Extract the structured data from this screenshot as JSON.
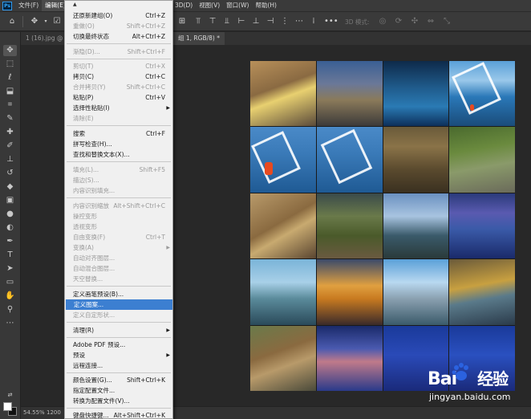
{
  "menubar": {
    "logo": "Ps",
    "items": [
      "文件(F)",
      "编辑(E)"
    ],
    "right_items": [
      "3D(D)",
      "视图(V)",
      "窗口(W)",
      "帮助(H)"
    ]
  },
  "optionsbar": {
    "mode_3d": "3D 模式:"
  },
  "tabs": [
    {
      "label": "1 (16).jpg @"
    },
    {
      "label": "组 1, RGB/8) *"
    }
  ],
  "statusbar": {
    "zoom": "54.55%",
    "size": "1200"
  },
  "edit_menu": {
    "items": [
      {
        "label": "还原新建组(O)",
        "shortcut": "Ctrl+Z",
        "disabled": false
      },
      {
        "label": "重做(O)",
        "shortcut": "Shift+Ctrl+Z",
        "disabled": true
      },
      {
        "label": "切换最终状态",
        "shortcut": "Alt+Ctrl+Z",
        "disabled": false
      },
      {
        "label": "渐隐(D)...",
        "shortcut": "Shift+Ctrl+F",
        "disabled": true
      },
      {
        "label": "剪切(T)",
        "shortcut": "Ctrl+X",
        "disabled": true
      },
      {
        "label": "拷贝(C)",
        "shortcut": "Ctrl+C",
        "disabled": false
      },
      {
        "label": "合并拷贝(Y)",
        "shortcut": "Shift+Ctrl+C",
        "disabled": true
      },
      {
        "label": "粘贴(P)",
        "shortcut": "Ctrl+V",
        "disabled": false
      },
      {
        "label": "选择性粘贴(I)",
        "shortcut": "",
        "disabled": false
      },
      {
        "label": "清除(E)",
        "shortcut": "",
        "disabled": true
      },
      {
        "label": "搜索",
        "shortcut": "Ctrl+F",
        "disabled": false
      },
      {
        "label": "拼写检查(H)...",
        "shortcut": "",
        "disabled": false
      },
      {
        "label": "查找和替换文本(X)...",
        "shortcut": "",
        "disabled": false
      },
      {
        "label": "填充(L)...",
        "shortcut": "Shift+F5",
        "disabled": true
      },
      {
        "label": "描边(S)...",
        "shortcut": "",
        "disabled": true
      },
      {
        "label": "内容识别填充...",
        "shortcut": "",
        "disabled": true
      },
      {
        "label": "内容识别缩放",
        "shortcut": "Alt+Shift+Ctrl+C",
        "disabled": true
      },
      {
        "label": "操控变形",
        "shortcut": "",
        "disabled": true
      },
      {
        "label": "透视变形",
        "shortcut": "",
        "disabled": true
      },
      {
        "label": "自由变换(F)",
        "shortcut": "Ctrl+T",
        "disabled": true
      },
      {
        "label": "变换(A)",
        "shortcut": "",
        "disabled": true
      },
      {
        "label": "自动对齐图层...",
        "shortcut": "",
        "disabled": true
      },
      {
        "label": "自动混合图层...",
        "shortcut": "",
        "disabled": true
      },
      {
        "label": "天空替换...",
        "shortcut": "",
        "disabled": true
      },
      {
        "label": "定义画笔预设(B)...",
        "shortcut": "",
        "disabled": false
      },
      {
        "label": "定义图案...",
        "shortcut": "",
        "disabled": false
      },
      {
        "label": "定义自定形状...",
        "shortcut": "",
        "disabled": true
      },
      {
        "label": "清理(R)",
        "shortcut": "",
        "disabled": false
      },
      {
        "label": "Adobe PDF 预设...",
        "shortcut": "",
        "disabled": false
      },
      {
        "label": "预设",
        "shortcut": "",
        "disabled": false
      },
      {
        "label": "远程连接...",
        "shortcut": "",
        "disabled": false
      },
      {
        "label": "颜色设置(G)...",
        "shortcut": "Shift+Ctrl+K",
        "disabled": false
      },
      {
        "label": "指定配置文件...",
        "shortcut": "",
        "disabled": false
      },
      {
        "label": "转换为配置文件(V)...",
        "shortcut": "",
        "disabled": false
      },
      {
        "label": "键盘快捷键...",
        "shortcut": "Alt+Shift+Ctrl+K",
        "disabled": false
      }
    ]
  },
  "watermark": {
    "logo_text_left": "Bai",
    "logo_text_right": "经验",
    "site": "jingyan.baidu.com"
  }
}
